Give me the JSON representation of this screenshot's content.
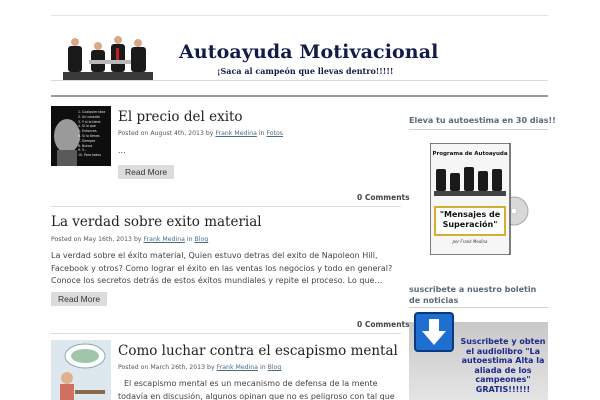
{
  "header": {
    "title": "Autoayuda Motivacional",
    "tagline": "¡Saca al campeón que llevas dentro!!!!!"
  },
  "posts": [
    {
      "title": "El precio del exito",
      "meta_prefix": "Posted on August 4th, 2013 by",
      "author": "Frank Medina",
      "in": "in",
      "category": "Fotos",
      "excerpt": "...",
      "read_more": "Read More",
      "comments": "0 Comments"
    },
    {
      "title": "La verdad sobre exito material",
      "meta_prefix": "Posted on May 16th, 2013 by",
      "author": "Frank Medina",
      "in": "in",
      "category": "Blog",
      "excerpt": "La verdad sobre el éxito material, Quien estuvo detras del exito de Napoleon Hill, Facebook y otros? Como lograr el éxito en las ventas los negocios y todo en general? Conoce los secretos detrás de estos éxitos mundiales y repite el proceso. Lo que…",
      "read_more": "Read More",
      "comments": "0 Comments"
    },
    {
      "title": "Como luchar contra el escapismo mental",
      "meta_prefix": "Posted on March 26th, 2013 by",
      "author": "Frank Medina",
      "in": "in",
      "category": "Blog",
      "excerpt": "El escapismo mental es un mecanismo de defensa de la mente todavía en discusión, algunos opinan que no es peligroso con tal que"
    }
  ],
  "thumb1_lines": [
    "1. Cualquier idea",
    "2. Un corazón",
    "3. Y si lo tiene",
    "4. Si lo que",
    "5. Entonces",
    "6. Si lo tienes",
    "7. Siempre",
    "8. Nunca",
    "9. Y...",
    "10. Para todos"
  ],
  "sidebar": {
    "widget1_title": "Eleva tu autoestima en 30 dias!!",
    "dvd_title": "Programa de Autoayuda",
    "dvd_label": "\"Mensajes de Superación\"",
    "dvd_author": "por Frank Medina",
    "widget2_title": "suscribete a nuestro boletin de noticias",
    "newsletter_text": "Suscribete y obten el audiolibro \"La autoestima Alta la aliada de los campeones\" GRATIS!!!!!!"
  },
  "colors": {
    "title_navy": "#131b4a",
    "newsletter_blue": "#1b2a8a",
    "link": "#4a6a8a"
  }
}
